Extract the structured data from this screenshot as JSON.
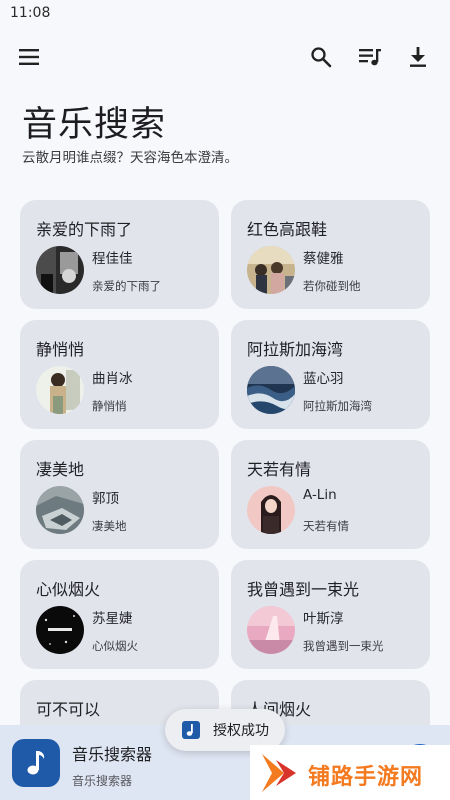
{
  "status_bar": {
    "time": "11:08"
  },
  "toolbar": {
    "menu_icon": "menu-icon",
    "search_icon": "search-icon",
    "queue_icon": "queue-music-icon",
    "download_icon": "download-icon"
  },
  "header": {
    "title": "音乐搜索",
    "subtitle": "云散月明谁点缀？天容海色本澄清。"
  },
  "cards": [
    {
      "title": "亲爱的下雨了",
      "singer": "程佳佳",
      "song": "亲爱的下雨了"
    },
    {
      "title": "红色高跟鞋",
      "singer": "蔡健雅",
      "song": "若你碰到他"
    },
    {
      "title": "静悄悄",
      "singer": "曲肖冰",
      "song": "静悄悄"
    },
    {
      "title": "阿拉斯加海湾",
      "singer": "蓝心羽",
      "song": "阿拉斯加海湾"
    },
    {
      "title": "凄美地",
      "singer": "郭顶",
      "song": "凄美地"
    },
    {
      "title": "天若有情",
      "singer": "A-Lin",
      "song": "天若有情"
    },
    {
      "title": "心似烟火",
      "singer": "苏星婕",
      "song": "心似烟火"
    },
    {
      "title": "我曾遇到一束光",
      "singer": "叶斯淳",
      "song": "我曾遇到一束光"
    },
    {
      "title": "可不可以",
      "singer": "",
      "song": ""
    },
    {
      "title": "人间烟火",
      "singer": "",
      "song": ""
    }
  ],
  "player": {
    "title": "音乐搜索器",
    "subtitle": "音乐搜索器",
    "art_icon": "music-note-icon"
  },
  "toast": {
    "text": "授权成功",
    "icon": "music-note-icon"
  },
  "watermark": {
    "text": "铺路手游网"
  },
  "colors": {
    "background": "#f7f8fb",
    "card": "#e2e4ec",
    "player_bar": "#dfe6f3",
    "accent": "#1f5aa8",
    "watermark": "#f47a20"
  }
}
